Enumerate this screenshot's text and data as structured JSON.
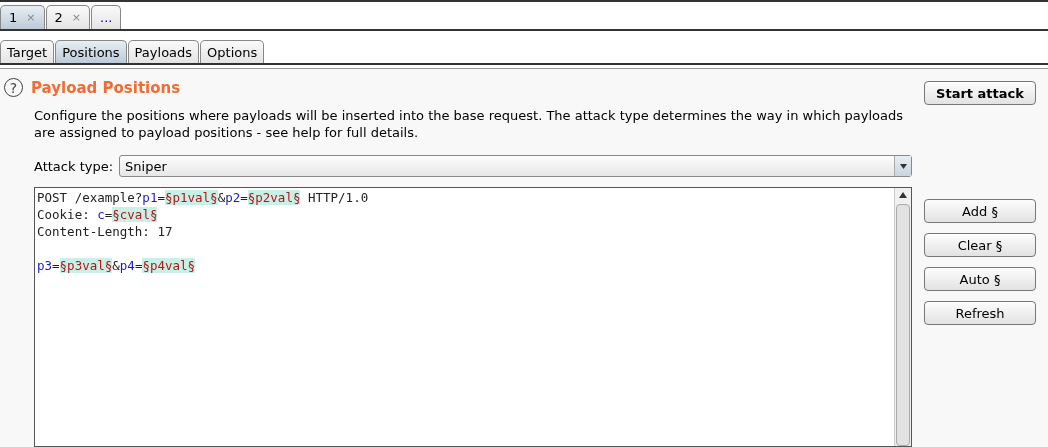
{
  "attack_tabs": [
    {
      "label": "1",
      "close": "×",
      "selected": true
    },
    {
      "label": "2",
      "close": "×",
      "selected": false
    },
    {
      "label": "...",
      "selected": false
    }
  ],
  "tabs": [
    {
      "label": "Target",
      "selected": false
    },
    {
      "label": "Positions",
      "selected": true
    },
    {
      "label": "Payloads",
      "selected": false
    },
    {
      "label": "Options",
      "selected": false
    }
  ],
  "help": "?",
  "title": "Payload Positions",
  "description": "Configure the positions where payloads will be inserted into the base request. The attack type determines the way in which payloads are assigned to payload positions - see help for full details.",
  "start_button": "Start attack",
  "attack_type": {
    "label": "Attack type:",
    "value": "Sniper"
  },
  "request_lines": [
    {
      "kind": "text",
      "segments": [
        {
          "kind": "plain",
          "text": "POST /example?"
        },
        {
          "kind": "param",
          "text": "p1"
        },
        {
          "kind": "plain",
          "text": "="
        },
        {
          "kind": "payload",
          "text": "§p1val§"
        },
        {
          "kind": "plain",
          "text": "&"
        },
        {
          "kind": "param",
          "text": "p2"
        },
        {
          "kind": "plain",
          "text": "="
        },
        {
          "kind": "payload",
          "text": "§p2val§"
        },
        {
          "kind": "plain",
          "text": " HTTP/1.0"
        }
      ]
    },
    {
      "kind": "text",
      "segments": [
        {
          "kind": "plain",
          "text": "Cookie: "
        },
        {
          "kind": "param",
          "text": "c"
        },
        {
          "kind": "plain",
          "text": "="
        },
        {
          "kind": "payload",
          "text": "§cval§"
        }
      ]
    },
    {
      "kind": "text",
      "segments": [
        {
          "kind": "plain",
          "text": "Content-Length: 17"
        }
      ]
    },
    {
      "kind": "blank"
    },
    {
      "kind": "text",
      "segments": [
        {
          "kind": "param",
          "text": "p3"
        },
        {
          "kind": "plain",
          "text": "="
        },
        {
          "kind": "payload",
          "text": "§p3val§"
        },
        {
          "kind": "plain",
          "text": "&"
        },
        {
          "kind": "param",
          "text": "p4"
        },
        {
          "kind": "plain",
          "text": "="
        },
        {
          "kind": "payload",
          "text": "§p4val§"
        }
      ]
    }
  ],
  "side_buttons": [
    "Add §",
    "Clear §",
    "Auto §",
    "Refresh"
  ]
}
